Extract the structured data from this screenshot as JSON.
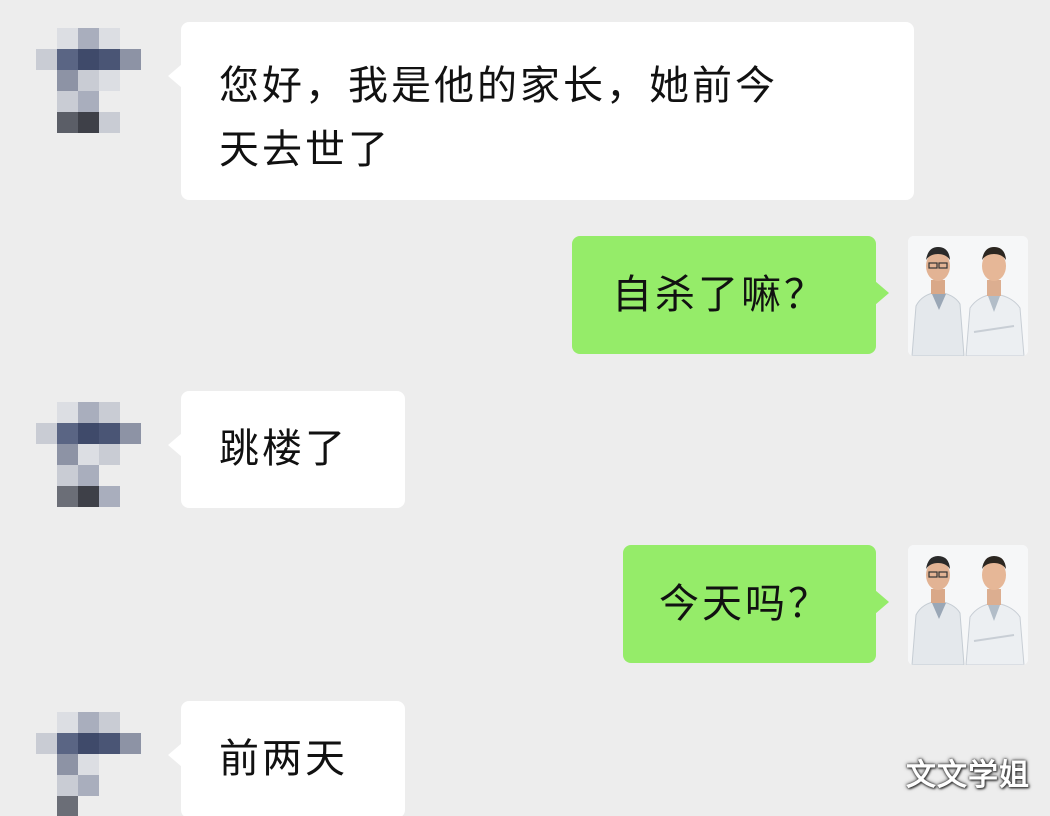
{
  "chat": {
    "messages": [
      {
        "id": "m1",
        "direction": "incoming",
        "lines": [
          "您好，我是他的家长，她前今",
          "天去世了"
        ]
      },
      {
        "id": "m2",
        "direction": "outgoing",
        "text": "自杀了嘛？"
      },
      {
        "id": "m3",
        "direction": "incoming",
        "text": "跳楼了"
      },
      {
        "id": "m4",
        "direction": "outgoing",
        "text": "今天吗？"
      },
      {
        "id": "m5",
        "direction": "incoming",
        "text": "前两天"
      }
    ]
  },
  "avatars": {
    "incoming": {
      "icon": "pixelated-avatar-icon",
      "colors": [
        "#ffffff",
        "#dcdee3",
        "#8d93a5",
        "#3f4a6a",
        "#a9aebd",
        "#c9ccd4",
        "#5b5e67"
      ]
    },
    "outgoing": {
      "icon": "two-doctors-photo-icon"
    }
  },
  "colors": {
    "background": "#ededed",
    "incoming_bubble": "#ffffff",
    "outgoing_bubble": "#95ec69",
    "text": "#111111"
  },
  "watermark": {
    "text": "文文学姐"
  }
}
